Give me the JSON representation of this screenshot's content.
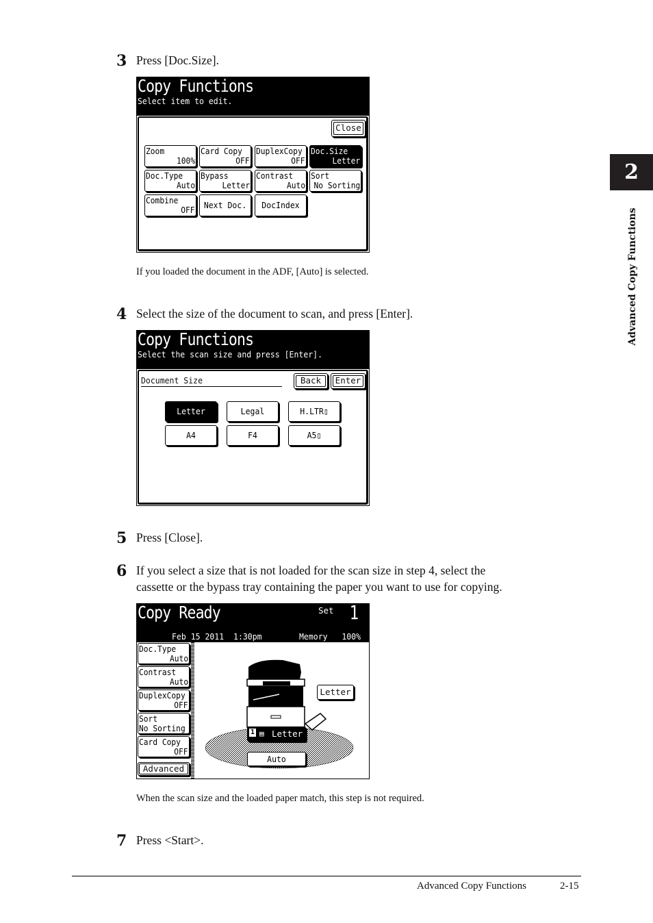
{
  "side_tab": {
    "chapter": "2",
    "label": "Advanced Copy Functions"
  },
  "steps": [
    {
      "number": "3",
      "text": "Press [Doc.Size]."
    },
    {
      "number": "4",
      "text": "Select the size of the document to scan, and press [Enter]."
    },
    {
      "number": "5",
      "text": "Press [Close]."
    },
    {
      "number": "6",
      "text_line1": "If you select a size that is not loaded for the scan size in step 4, select the",
      "text_line2": "cassette or the bypass tray containing the paper you want to use for copying."
    },
    {
      "number": "7",
      "text": "Press <Start>."
    }
  ],
  "notes": {
    "after_step3": "If you loaded the document in the ADF, [Auto] is selected.",
    "after_step6": "When the scan size and the loaded paper match, this step is not required."
  },
  "screen1": {
    "title": "Copy Functions",
    "subtitle": "Select item to edit.",
    "close_label": "Close",
    "buttons": [
      {
        "label": "Zoom",
        "value": "100%",
        "selected": false
      },
      {
        "label": "Card Copy",
        "value": "OFF",
        "selected": false
      },
      {
        "label": "DuplexCopy",
        "value": "OFF",
        "selected": false
      },
      {
        "label": "Doc.Size",
        "value": "Letter",
        "selected": true
      },
      {
        "label": "Doc.Type",
        "value": "Auto",
        "selected": false
      },
      {
        "label": "Bypass",
        "value": "Letter",
        "selected": false
      },
      {
        "label": "Contrast",
        "value": "Auto",
        "selected": false
      },
      {
        "label": "Sort",
        "value": "No Sorting",
        "selected": false
      },
      {
        "label": "Combine",
        "value": "OFF",
        "selected": false
      },
      {
        "label": "Next Doc.",
        "value": "",
        "selected": false
      },
      {
        "label": "DocIndex",
        "value": "",
        "selected": false
      }
    ]
  },
  "screen2": {
    "title": "Copy Functions",
    "subtitle": "Select the scan size and press [Enter].",
    "section_label": "Document Size",
    "back_label": "Back",
    "enter_label": "Enter",
    "sizes": [
      {
        "label": "Letter",
        "selected": true
      },
      {
        "label": "Legal",
        "selected": false
      },
      {
        "label": "H.LTR▯",
        "selected": false
      },
      {
        "label": "A4",
        "selected": false
      },
      {
        "label": "F4",
        "selected": false
      },
      {
        "label": "A5▯",
        "selected": false
      }
    ]
  },
  "screen3": {
    "title": "Copy Ready",
    "set_label": "Set",
    "set_count": "1",
    "date": "Feb 15 2011",
    "time": "1:30pm",
    "memory_label": "Memory",
    "memory_value": "100%",
    "side_buttons": [
      {
        "label": "Doc.Type",
        "value": "Auto"
      },
      {
        "label": "Contrast",
        "value": "Auto"
      },
      {
        "label": "DuplexCopy",
        "value": "OFF"
      },
      {
        "label": "Sort",
        "value": "No Sorting"
      },
      {
        "label": "Card Copy",
        "value": "OFF"
      }
    ],
    "advanced_label": "Advanced",
    "bypass_size": "Letter",
    "cassette_number": "1",
    "cassette_size": "Letter",
    "output_label": "Auto"
  },
  "footer": {
    "section": "Advanced Copy Functions",
    "page": "2-15"
  }
}
